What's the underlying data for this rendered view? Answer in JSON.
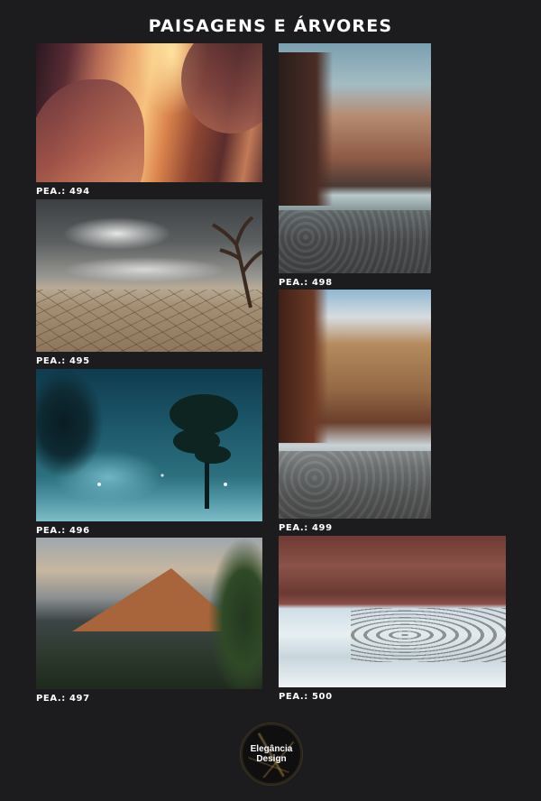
{
  "title": "PAISAGENS E ÁRVORES",
  "items": [
    {
      "code": "PEA.: 494"
    },
    {
      "code": "PEA.: 495"
    },
    {
      "code": "PEA.: 496"
    },
    {
      "code": "PEA.: 497"
    },
    {
      "code": "PEA.: 498"
    },
    {
      "code": "PEA.: 499"
    },
    {
      "code": "PEA.: 500"
    }
  ],
  "logo": {
    "line1": "Elegância",
    "line2": "Design"
  },
  "colors": {
    "background": "#1c1c1e",
    "text": "#ffffff"
  }
}
